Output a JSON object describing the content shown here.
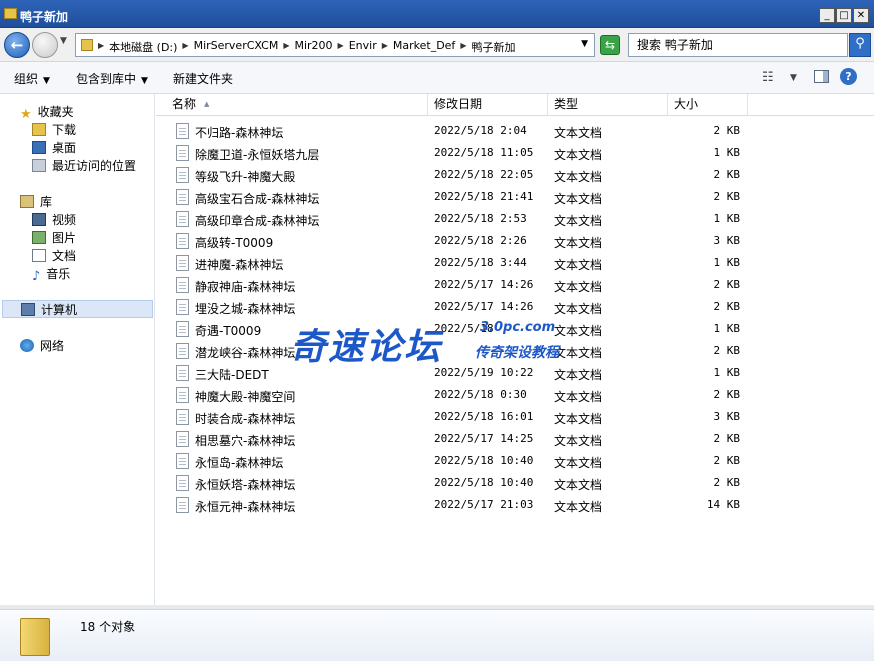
{
  "window": {
    "title": "鸭子新加",
    "controls": [
      "_",
      "□",
      "✕"
    ]
  },
  "address": {
    "crumbs": [
      "本地磁盘 (D:)",
      "MirServerCXCM",
      "Mir200",
      "Envir",
      "Market_Def",
      "鸭子新加"
    ],
    "search_placeholder": "搜索 鸭子新加"
  },
  "toolbar": {
    "organize": "组织",
    "include_in_library": "包含到库中",
    "new_folder": "新建文件夹"
  },
  "sidebar": {
    "favorites": "收藏夹",
    "downloads": "下载",
    "desktop": "桌面",
    "recent": "最近访问的位置",
    "libraries": "库",
    "videos": "视频",
    "pictures": "图片",
    "documents": "文档",
    "music": "音乐",
    "computer": "计算机",
    "network": "网络"
  },
  "columns": {
    "name": "名称",
    "date": "修改日期",
    "type": "类型",
    "size": "大小"
  },
  "files": [
    {
      "name": "不归路-森林神坛",
      "date": "2022/5/18 2:04",
      "type": "文本文档",
      "size": "2 KB"
    },
    {
      "name": "除魔卫道-永恒妖塔九层",
      "date": "2022/5/18 11:05",
      "type": "文本文档",
      "size": "1 KB"
    },
    {
      "name": "等级飞升-神魔大殿",
      "date": "2022/5/18 22:05",
      "type": "文本文档",
      "size": "2 KB"
    },
    {
      "name": "高级宝石合成-森林神坛",
      "date": "2022/5/18 21:41",
      "type": "文本文档",
      "size": "2 KB"
    },
    {
      "name": "高级印章合成-森林神坛",
      "date": "2022/5/18 2:53",
      "type": "文本文档",
      "size": "1 KB"
    },
    {
      "name": "高级转-T0009",
      "date": "2022/5/18 2:26",
      "type": "文本文档",
      "size": "3 KB"
    },
    {
      "name": "进神魔-森林神坛",
      "date": "2022/5/18 3:44",
      "type": "文本文档",
      "size": "1 KB"
    },
    {
      "name": "静寂神庙-森林神坛",
      "date": "2022/5/17 14:26",
      "type": "文本文档",
      "size": "2 KB"
    },
    {
      "name": "埋没之城-森林神坛",
      "date": "2022/5/17 14:26",
      "type": "文本文档",
      "size": "2 KB"
    },
    {
      "name": "奇遇-T0009",
      "date": "2022/5/18",
      "type": "文本文档",
      "size": "1 KB"
    },
    {
      "name": "潜龙峡谷-森林神坛",
      "date": "",
      "type": "文本文档",
      "size": "2 KB"
    },
    {
      "name": "三大陆-DEDT",
      "date": "2022/5/19 10:22",
      "type": "文本文档",
      "size": "1 KB"
    },
    {
      "name": "神魔大殿-神魔空间",
      "date": "2022/5/18 0:30",
      "type": "文本文档",
      "size": "2 KB"
    },
    {
      "name": "时装合成-森林神坛",
      "date": "2022/5/18 16:01",
      "type": "文本文档",
      "size": "3 KB"
    },
    {
      "name": "相思墓穴-森林神坛",
      "date": "2022/5/17 14:25",
      "type": "文本文档",
      "size": "2 KB"
    },
    {
      "name": "永恒岛-森林神坛",
      "date": "2022/5/18 10:40",
      "type": "文本文档",
      "size": "2 KB"
    },
    {
      "name": "永恒妖塔-森林神坛",
      "date": "2022/5/18 10:40",
      "type": "文本文档",
      "size": "2 KB"
    },
    {
      "name": "永恒元神-森林神坛",
      "date": "2022/5/17 21:03",
      "type": "文本文档",
      "size": "14 KB"
    }
  ],
  "status": {
    "count": "18 个对象"
  },
  "watermark": {
    "main": "奇速论坛",
    "url": "3.0pc.com",
    "sub": "传奇架设教程"
  }
}
